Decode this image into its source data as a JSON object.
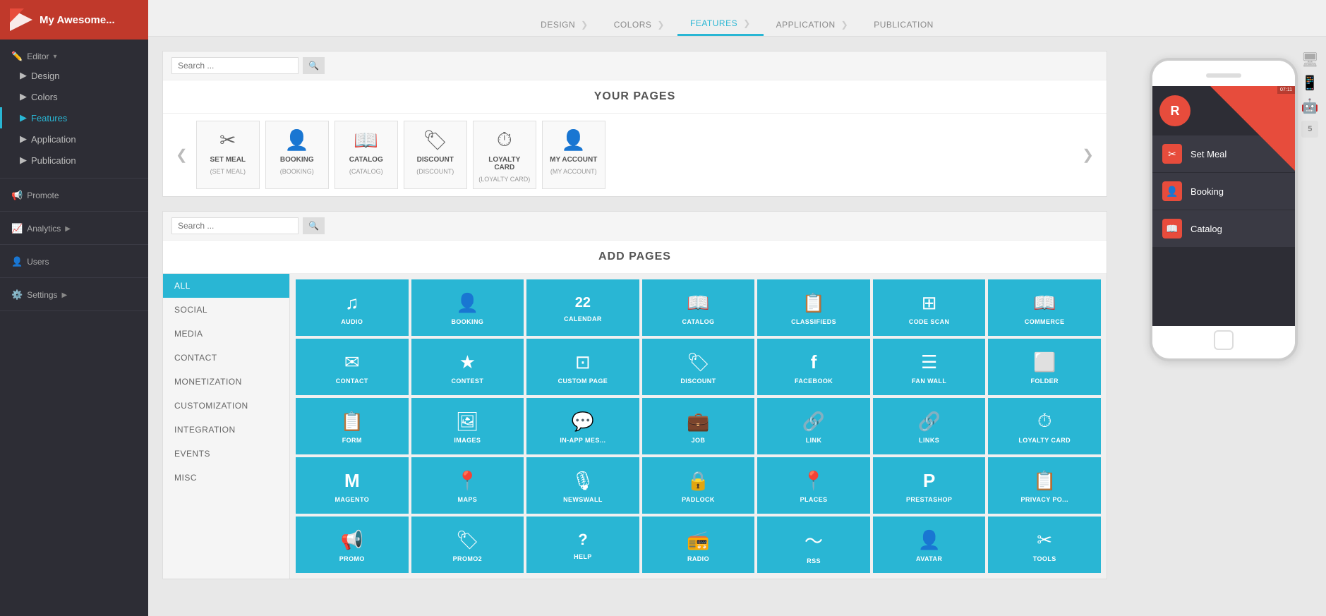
{
  "sidebar": {
    "app_name": "My Awesome...",
    "sections": [
      {
        "id": "editor",
        "label": "Editor",
        "icon": "✏️",
        "has_arrow": true,
        "items": [
          {
            "id": "design",
            "label": "Design",
            "active": false
          },
          {
            "id": "colors",
            "label": "Colors",
            "active": false
          },
          {
            "id": "features",
            "label": "Features",
            "active": true
          },
          {
            "id": "application",
            "label": "Application",
            "active": false
          },
          {
            "id": "publication",
            "label": "Publication",
            "active": false
          }
        ]
      },
      {
        "id": "promote",
        "label": "Promote",
        "icon": "📢",
        "has_arrow": false,
        "items": []
      },
      {
        "id": "analytics",
        "label": "Analytics",
        "icon": "📈",
        "has_arrow": true,
        "items": []
      },
      {
        "id": "users",
        "label": "Users",
        "icon": "👤",
        "has_arrow": false,
        "items": []
      },
      {
        "id": "settings",
        "label": "Settings",
        "icon": "⚙️",
        "has_arrow": true,
        "items": []
      }
    ]
  },
  "breadcrumb": {
    "items": [
      {
        "label": "DESIGN",
        "active": false
      },
      {
        "label": "COLORS",
        "active": false
      },
      {
        "label": "FEATURES",
        "active": true
      },
      {
        "label": "APPLICATION",
        "active": false
      },
      {
        "label": "PUBLICATION",
        "active": false
      }
    ]
  },
  "your_pages": {
    "title": "YOUR PAGES",
    "search_placeholder": "Search ...",
    "pages": [
      {
        "id": "set-meal",
        "name": "SET MEAL",
        "sub": "(SET MEAL)",
        "icon": "✂"
      },
      {
        "id": "booking",
        "name": "BOOKING",
        "sub": "(BOOKING)",
        "icon": "👤"
      },
      {
        "id": "catalog",
        "name": "CATALOG",
        "sub": "(CATALOG)",
        "icon": "📖"
      },
      {
        "id": "discount",
        "name": "DISCOUNT",
        "sub": "(DISCOUNT)",
        "icon": "🏷"
      },
      {
        "id": "loyalty-card",
        "name": "LOYALTY CARD",
        "sub": "(LOYALTY CARD)",
        "icon": "⏱"
      },
      {
        "id": "my-account",
        "name": "MY ACCOUNT",
        "sub": "(MY ACCOUNT)",
        "icon": "👤"
      }
    ]
  },
  "add_pages": {
    "title": "ADD PAGES",
    "search_placeholder": "Search ...",
    "categories": [
      {
        "id": "all",
        "label": "ALL",
        "active": true
      },
      {
        "id": "social",
        "label": "SOCIAL",
        "active": false
      },
      {
        "id": "media",
        "label": "MEDIA",
        "active": false
      },
      {
        "id": "contact",
        "label": "CONTACT",
        "active": false
      },
      {
        "id": "monetization",
        "label": "MONETIZATION",
        "active": false
      },
      {
        "id": "customization",
        "label": "CUSTOMIZATION",
        "active": false
      },
      {
        "id": "integration",
        "label": "INTEGRATION",
        "active": false
      },
      {
        "id": "events",
        "label": "EVENTS",
        "active": false
      },
      {
        "id": "misc",
        "label": "MISC",
        "active": false
      }
    ],
    "page_types": [
      {
        "id": "audio",
        "label": "AUDIO",
        "icon": "♫"
      },
      {
        "id": "booking",
        "label": "BOOKING",
        "icon": "👤"
      },
      {
        "id": "calendar",
        "label": "22 CALENDAR",
        "icon": "22"
      },
      {
        "id": "catalog",
        "label": "CATALOG",
        "icon": "📖"
      },
      {
        "id": "classifieds",
        "label": "CLASSIFIEDS",
        "icon": "📋"
      },
      {
        "id": "code-scan",
        "label": "CODE SCAN",
        "icon": "⊞"
      },
      {
        "id": "commerce",
        "label": "COMMERCE",
        "icon": "📖"
      },
      {
        "id": "contact",
        "label": "CONTACT",
        "icon": "✉"
      },
      {
        "id": "contest",
        "label": "CONTEST",
        "icon": "★"
      },
      {
        "id": "custom-page",
        "label": "CUSTOM PAGE",
        "icon": "⊡"
      },
      {
        "id": "discount",
        "label": "DISCOUNT",
        "icon": "🏷"
      },
      {
        "id": "facebook",
        "label": "FACEBOOK",
        "icon": "f"
      },
      {
        "id": "fan-wall",
        "label": "FAN WALL",
        "icon": "☰"
      },
      {
        "id": "folder",
        "label": "FOLDER",
        "icon": "⬜"
      },
      {
        "id": "form",
        "label": "FORM",
        "icon": "📋"
      },
      {
        "id": "images",
        "label": "IMAGES",
        "icon": "🖼"
      },
      {
        "id": "in-app-mes",
        "label": "IN-APP MES...",
        "icon": "💬"
      },
      {
        "id": "job",
        "label": "JOB",
        "icon": "💼"
      },
      {
        "id": "link",
        "label": "LINK",
        "icon": "🔗"
      },
      {
        "id": "links",
        "label": "LINKS",
        "icon": "🔗"
      },
      {
        "id": "loyalty-card",
        "label": "LOYALTY CARD",
        "icon": "⏱"
      },
      {
        "id": "magento",
        "label": "MAGENTO",
        "icon": "M"
      },
      {
        "id": "maps",
        "label": "MAPS",
        "icon": "📍"
      },
      {
        "id": "newswall",
        "label": "NEWSWALL",
        "icon": "🎙"
      },
      {
        "id": "padlock",
        "label": "PADLOCK",
        "icon": "🔒"
      },
      {
        "id": "places",
        "label": "PLACES",
        "icon": "📍"
      },
      {
        "id": "prestashop",
        "label": "PRESTASHOP",
        "icon": "P"
      },
      {
        "id": "privacy-po",
        "label": "PRIVACY PO...",
        "icon": "📋"
      },
      {
        "id": "promo",
        "label": "PROMO",
        "icon": "📢"
      },
      {
        "id": "promo2",
        "label": "PROMO2",
        "icon": "🏷"
      },
      {
        "id": "help",
        "label": "HELP",
        "icon": "?"
      },
      {
        "id": "radio",
        "label": "RADIO",
        "icon": "📻"
      },
      {
        "id": "rss",
        "label": "RSS",
        "icon": "〜"
      },
      {
        "id": "avatar-page",
        "label": "AVATAR",
        "icon": "👤"
      },
      {
        "id": "tools",
        "label": "TOOLS",
        "icon": "✂"
      }
    ]
  },
  "phone_preview": {
    "app_logo_initials": "R",
    "status_bar": "07:11",
    "menu_items": [
      {
        "label": "Set Meal",
        "icon": "✂"
      },
      {
        "label": "Booking",
        "icon": "👤"
      },
      {
        "label": "Catalog",
        "icon": "📖"
      }
    ],
    "platform_icons": [
      {
        "id": "apple-desktop",
        "symbol": ""
      },
      {
        "id": "apple-mobile",
        "symbol": ""
      },
      {
        "id": "android",
        "symbol": ""
      },
      {
        "id": "html5",
        "symbol": "5"
      }
    ]
  }
}
